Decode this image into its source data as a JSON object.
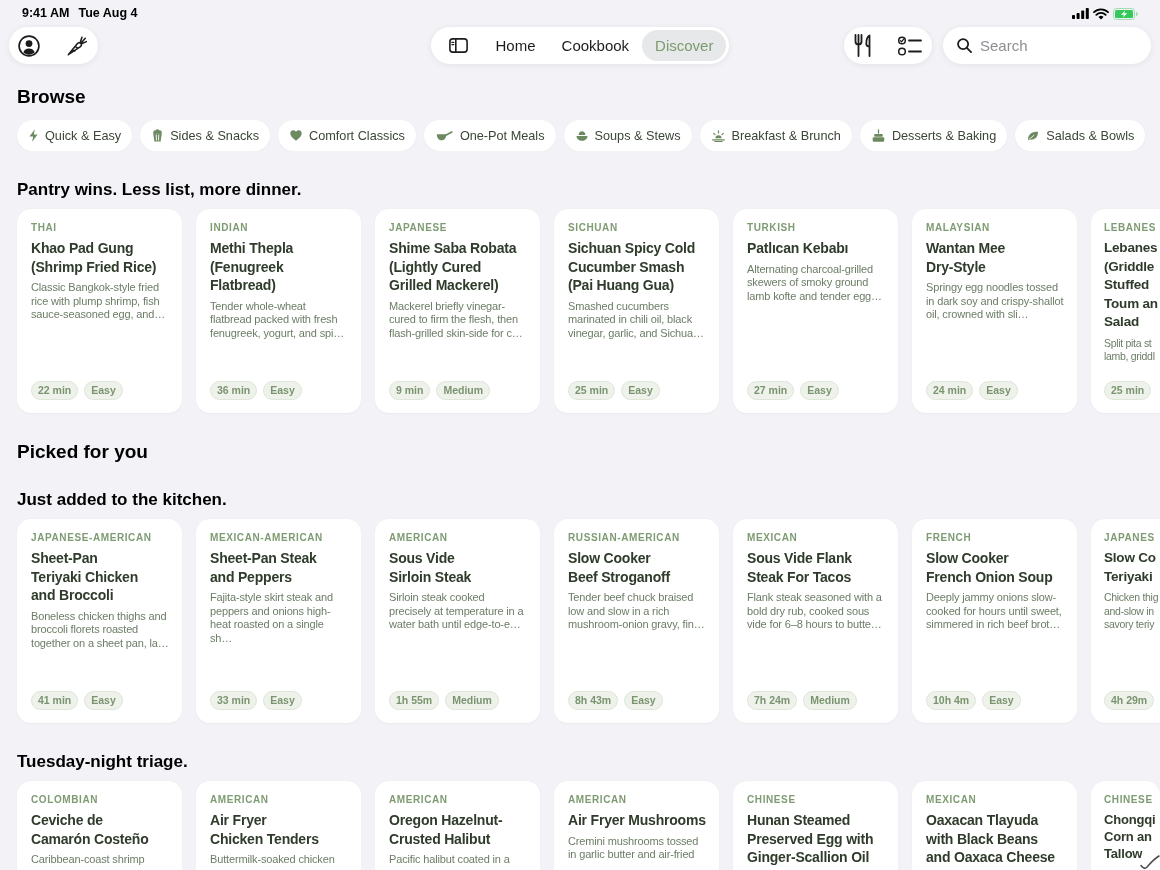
{
  "status_bar": {
    "time": "9:41 AM",
    "date": "Tue Aug 4"
  },
  "toolbar": {
    "tabs": [
      {
        "label": "Home",
        "selected": false
      },
      {
        "label": "Cookbook",
        "selected": false
      },
      {
        "label": "Discover",
        "selected": true
      }
    ],
    "search": {
      "placeholder": "Search"
    }
  },
  "browse": {
    "title": "Browse",
    "chips": [
      "Quick & Easy",
      "Sides & Snacks",
      "Comfort Classics",
      "One-Pot Meals",
      "Soups & Stews",
      "Breakfast & Brunch",
      "Desserts & Baking",
      "Salads & Bowls"
    ]
  },
  "sections": [
    {
      "title": "Pantry wins. Less list, more dinner.",
      "cards": [
        {
          "cuisine": "THAI",
          "title": "Khao Pad Gung (Shrimp Fried Rice)",
          "description": "Classic Bangkok-style fried rice with plump shrimp, fish sauce-seasoned egg, and…",
          "time": "22 min",
          "difficulty": "Easy"
        },
        {
          "cuisine": "INDIAN",
          "title": "Methi Thepla (Fenugreek Flatbread)",
          "description": "Tender whole-wheat flatbread packed with fresh fenugreek, yogurt, and spi…",
          "time": "36 min",
          "difficulty": "Easy"
        },
        {
          "cuisine": "JAPANESE",
          "title": "Shime Saba Robata (Lightly Cured Grilled Mackerel)",
          "description": "Mackerel briefly vinegar-cured to firm the flesh, then flash-grilled skin-side for c…",
          "time": "9 min",
          "difficulty": "Medium"
        },
        {
          "cuisine": "SICHUAN",
          "title": "Sichuan Spicy Cold Cucumber Smash (Pai Huang Gua)",
          "description": "Smashed cucumbers marinated in chili oil, black vinegar, garlic, and Sichua…",
          "time": "25 min",
          "difficulty": "Easy"
        },
        {
          "cuisine": "TURKISH",
          "title": "Patlıcan Kebabı",
          "description": "Alternating charcoal-grilled skewers of smoky ground lamb kofte and tender egg…",
          "time": "27 min",
          "difficulty": "Easy"
        },
        {
          "cuisine": "MALAYSIAN",
          "title": "Wantan Mee Dry-Style",
          "description": "Springy egg noodles tossed in dark soy and crispy-shallot oil, crowned with sli…",
          "time": "24 min",
          "difficulty": "Easy"
        },
        {
          "cuisine": "LEBANES",
          "title": "Lebanes\n(Griddle\nStuffed\nToum an\nSalad",
          "description": "Split pita st\nlamb, griddl",
          "time": "25 min"
        }
      ]
    },
    {
      "heading": "Picked for you",
      "title": "Just added to the kitchen.",
      "cards": [
        {
          "cuisine": "JAPANESE-AMERICAN",
          "title": "Sheet-Pan Teriyaki Chicken and Broccoli",
          "description": "Boneless chicken thighs and broccoli florets roasted together on a sheet pan, la…",
          "time": "41 min",
          "difficulty": "Easy"
        },
        {
          "cuisine": "MEXICAN-AMERICAN",
          "title": "Sheet-Pan Steak and Peppers",
          "description": "Fajita-style skirt steak and peppers and onions high-heat roasted on a single sh…",
          "time": "33 min",
          "difficulty": "Easy"
        },
        {
          "cuisine": "AMERICAN",
          "title": "Sous Vide Sirloin Steak",
          "description": "Sirloin steak cooked precisely at temperature in a water bath until edge-to-e…",
          "time": "1h 55m",
          "difficulty": "Medium"
        },
        {
          "cuisine": "RUSSIAN-AMERICAN",
          "title": "Slow Cooker Beef Stroganoff",
          "description": "Tender beef chuck braised low and slow in a rich mushroom-onion gravy, fin…",
          "time": "8h 43m",
          "difficulty": "Easy"
        },
        {
          "cuisine": "MEXICAN",
          "title": "Sous Vide Flank Steak For Tacos",
          "description": "Flank steak seasoned with a bold dry rub, cooked sous vide for 6–8 hours to butte…",
          "time": "7h 24m",
          "difficulty": "Medium"
        },
        {
          "cuisine": "FRENCH",
          "title": "Slow Cooker French Onion Soup",
          "description": "Deeply jammy onions slow-cooked for hours until sweet, simmered in rich beef brot…",
          "time": "10h 4m",
          "difficulty": "Easy"
        },
        {
          "cuisine": "JAPANES",
          "title": "Slow Co\nTeriyaki",
          "description": "Chicken thig\nand-slow in\nsavory teriy",
          "time": "4h 29m"
        }
      ]
    },
    {
      "title": "Tuesday-night triage.",
      "cards": [
        {
          "cuisine": "COLOMBIAN",
          "title": "Ceviche de Camarón Costeño",
          "description": "Caribbean-coast shrimp"
        },
        {
          "cuisine": "AMERICAN",
          "title": "Air Fryer Chicken Tenders",
          "description": "Buttermilk-soaked chicken"
        },
        {
          "cuisine": "AMERICAN",
          "title": "Oregon Hazelnut-Crusted Halibut",
          "description": "Pacific halibut coated in a"
        },
        {
          "cuisine": "AMERICAN",
          "title": "Air Fryer Mushrooms",
          "description": "Cremini mushrooms tossed in garlic butter and air-fried"
        },
        {
          "cuisine": "CHINESE",
          "title": "Hunan Steamed Preserved Egg with Ginger-Scallion Oil"
        },
        {
          "cuisine": "MEXICAN",
          "title": "Oaxacan Tlayuda with Black Beans and Oaxaca Cheese"
        },
        {
          "cuisine": "CHINESE",
          "title": "Chongqi\nCorn an\nTallow"
        }
      ]
    }
  ]
}
